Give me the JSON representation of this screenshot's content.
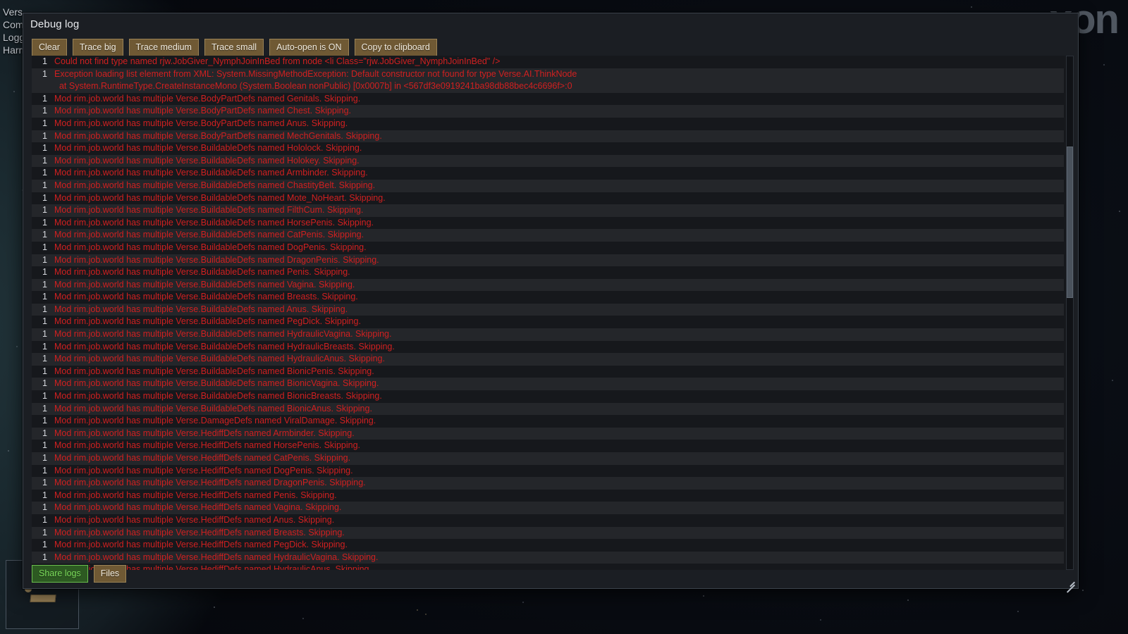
{
  "background": {
    "watermark": "xon",
    "menu_items": [
      "Vers",
      "Com",
      "Logg",
      "Harm"
    ]
  },
  "window": {
    "title": "Debug log"
  },
  "toolbar": {
    "buttons": [
      {
        "name": "clear-button",
        "label": "Clear"
      },
      {
        "name": "trace-big-button",
        "label": "Trace big"
      },
      {
        "name": "trace-medium-button",
        "label": "Trace medium"
      },
      {
        "name": "trace-small-button",
        "label": "Trace small"
      },
      {
        "name": "auto-open-toggle-button",
        "label": "Auto-open is ON"
      },
      {
        "name": "copy-to-clipboard-button",
        "label": "Copy to clipboard"
      }
    ]
  },
  "bottom_bar": {
    "share_logs_label": "Share logs",
    "files_label": "Files"
  },
  "colors": {
    "error_text": "#d02020",
    "button_background": "#6f5934",
    "button_border": "#9b8356",
    "share_logs_text": "#7ddf5c",
    "window_background": "#1b1e23",
    "row_dark": "#16181c",
    "row_light": "#24262a"
  },
  "log": {
    "entries": [
      {
        "count": "1",
        "message": "Could not find type named rjw.JobGiver_NymphJoinInBed from node <li Class=\"rjw.JobGiver_NymphJoinInBed\" />"
      },
      {
        "count": "1",
        "message": "Exception loading list element from XML: System.MissingMethodException: Default constructor not found for type Verse.AI.ThinkNode\n  at System.RuntimeType.CreateInstanceMono (System.Boolean nonPublic) [0x0007b] in <567df3e0919241ba98db88bec4c6696f>:0"
      },
      {
        "count": "1",
        "message": "Mod rim.job.world has multiple Verse.BodyPartDefs named Genitals. Skipping."
      },
      {
        "count": "1",
        "message": "Mod rim.job.world has multiple Verse.BodyPartDefs named Chest. Skipping."
      },
      {
        "count": "1",
        "message": "Mod rim.job.world has multiple Verse.BodyPartDefs named Anus. Skipping."
      },
      {
        "count": "1",
        "message": "Mod rim.job.world has multiple Verse.BodyPartDefs named MechGenitals. Skipping."
      },
      {
        "count": "1",
        "message": "Mod rim.job.world has multiple Verse.BuildableDefs named Hololock. Skipping."
      },
      {
        "count": "1",
        "message": "Mod rim.job.world has multiple Verse.BuildableDefs named Holokey. Skipping."
      },
      {
        "count": "1",
        "message": "Mod rim.job.world has multiple Verse.BuildableDefs named Armbinder. Skipping."
      },
      {
        "count": "1",
        "message": "Mod rim.job.world has multiple Verse.BuildableDefs named ChastityBelt. Skipping."
      },
      {
        "count": "1",
        "message": "Mod rim.job.world has multiple Verse.BuildableDefs named Mote_NoHeart. Skipping."
      },
      {
        "count": "1",
        "message": "Mod rim.job.world has multiple Verse.BuildableDefs named FilthCum. Skipping."
      },
      {
        "count": "1",
        "message": "Mod rim.job.world has multiple Verse.BuildableDefs named HorsePenis. Skipping."
      },
      {
        "count": "1",
        "message": "Mod rim.job.world has multiple Verse.BuildableDefs named CatPenis. Skipping."
      },
      {
        "count": "1",
        "message": "Mod rim.job.world has multiple Verse.BuildableDefs named DogPenis. Skipping."
      },
      {
        "count": "1",
        "message": "Mod rim.job.world has multiple Verse.BuildableDefs named DragonPenis. Skipping."
      },
      {
        "count": "1",
        "message": "Mod rim.job.world has multiple Verse.BuildableDefs named Penis. Skipping."
      },
      {
        "count": "1",
        "message": "Mod rim.job.world has multiple Verse.BuildableDefs named Vagina. Skipping."
      },
      {
        "count": "1",
        "message": "Mod rim.job.world has multiple Verse.BuildableDefs named Breasts. Skipping."
      },
      {
        "count": "1",
        "message": "Mod rim.job.world has multiple Verse.BuildableDefs named Anus. Skipping."
      },
      {
        "count": "1",
        "message": "Mod rim.job.world has multiple Verse.BuildableDefs named PegDick. Skipping."
      },
      {
        "count": "1",
        "message": "Mod rim.job.world has multiple Verse.BuildableDefs named HydraulicVagina. Skipping."
      },
      {
        "count": "1",
        "message": "Mod rim.job.world has multiple Verse.BuildableDefs named HydraulicBreasts. Skipping."
      },
      {
        "count": "1",
        "message": "Mod rim.job.world has multiple Verse.BuildableDefs named HydraulicAnus. Skipping."
      },
      {
        "count": "1",
        "message": "Mod rim.job.world has multiple Verse.BuildableDefs named BionicPenis. Skipping."
      },
      {
        "count": "1",
        "message": "Mod rim.job.world has multiple Verse.BuildableDefs named BionicVagina. Skipping."
      },
      {
        "count": "1",
        "message": "Mod rim.job.world has multiple Verse.BuildableDefs named BionicBreasts. Skipping."
      },
      {
        "count": "1",
        "message": "Mod rim.job.world has multiple Verse.BuildableDefs named BionicAnus. Skipping."
      },
      {
        "count": "1",
        "message": "Mod rim.job.world has multiple Verse.DamageDefs named ViralDamage. Skipping."
      },
      {
        "count": "1",
        "message": "Mod rim.job.world has multiple Verse.HediffDefs named Armbinder. Skipping."
      },
      {
        "count": "1",
        "message": "Mod rim.job.world has multiple Verse.HediffDefs named HorsePenis. Skipping."
      },
      {
        "count": "1",
        "message": "Mod rim.job.world has multiple Verse.HediffDefs named CatPenis. Skipping."
      },
      {
        "count": "1",
        "message": "Mod rim.job.world has multiple Verse.HediffDefs named DogPenis. Skipping."
      },
      {
        "count": "1",
        "message": "Mod rim.job.world has multiple Verse.HediffDefs named DragonPenis. Skipping."
      },
      {
        "count": "1",
        "message": "Mod rim.job.world has multiple Verse.HediffDefs named Penis. Skipping."
      },
      {
        "count": "1",
        "message": "Mod rim.job.world has multiple Verse.HediffDefs named Vagina. Skipping."
      },
      {
        "count": "1",
        "message": "Mod rim.job.world has multiple Verse.HediffDefs named Anus. Skipping."
      },
      {
        "count": "1",
        "message": "Mod rim.job.world has multiple Verse.HediffDefs named Breasts. Skipping."
      },
      {
        "count": "1",
        "message": "Mod rim.job.world has multiple Verse.HediffDefs named PegDick. Skipping."
      },
      {
        "count": "1",
        "message": "Mod rim.job.world has multiple Verse.HediffDefs named HydraulicVagina. Skipping."
      },
      {
        "count": "1",
        "message": "Mod rim.job.world has multiple Verse.HediffDefs named HydraulicAnus. Skipping."
      }
    ]
  }
}
